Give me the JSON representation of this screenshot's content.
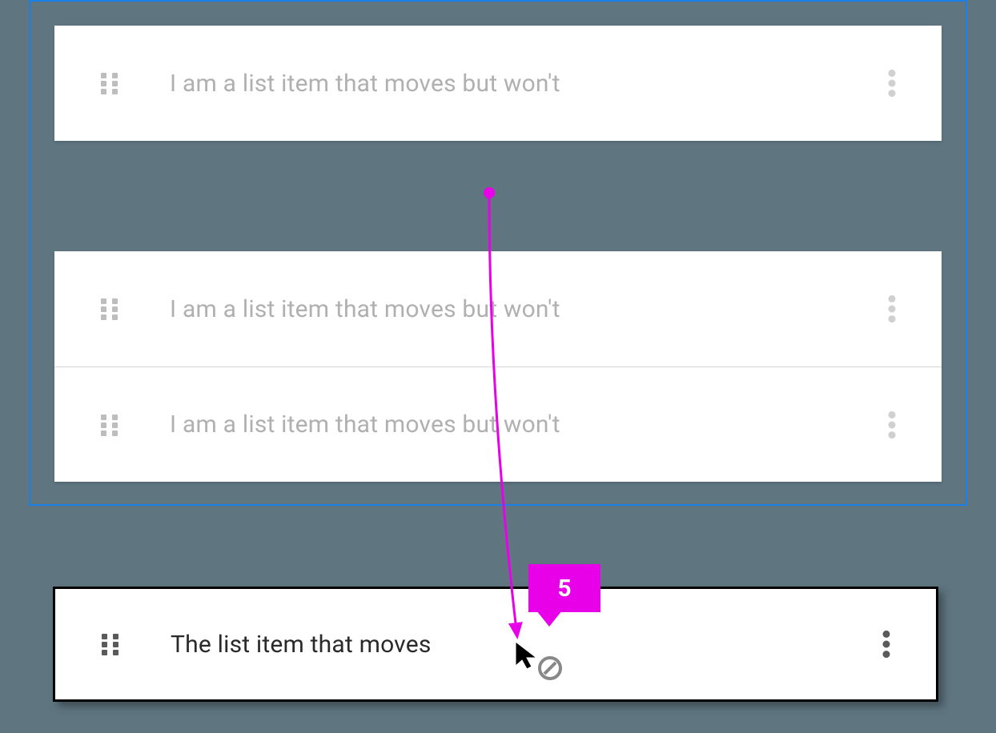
{
  "drop_zone": {
    "items": [
      {
        "label": "I am a list item that moves but won't"
      },
      {
        "label": "I am a list item that moves but won't"
      },
      {
        "label": "I am a list item that moves but won't"
      }
    ]
  },
  "dragged_item": {
    "label": "The list item that moves"
  },
  "annotation": {
    "badge": "5"
  }
}
